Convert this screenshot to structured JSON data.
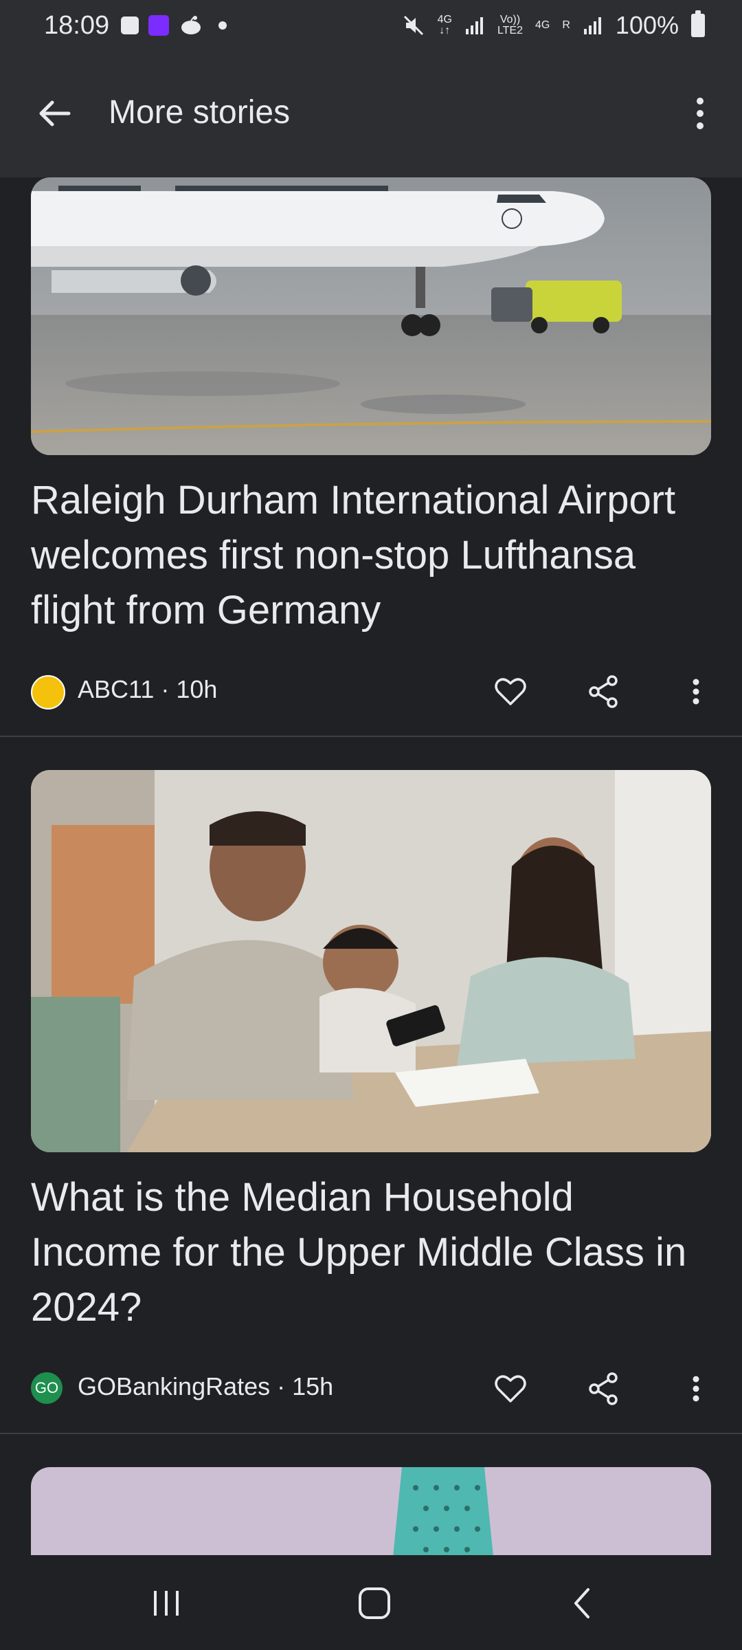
{
  "status_bar": {
    "time": "18:09",
    "network1": "4G",
    "volte": "Vo))",
    "volte_sub": "LTE2",
    "network2": "4G",
    "roaming": "R",
    "battery": "100%"
  },
  "app_bar": {
    "title": "More stories",
    "back_icon": "arrow-back-icon",
    "menu_icon": "more-vert-icon"
  },
  "stories": [
    {
      "headline": "Raleigh Durham International Airport welcomes first non-stop Lufthansa flight from Germany",
      "source_avatar": "",
      "source": "ABC11 · 10h"
    },
    {
      "headline": "What is the Median Household Income for the Upper Middle Class in 2024?",
      "source_avatar": "GO",
      "source": "GOBankingRates · 15h"
    }
  ],
  "colors": {
    "background": "#202124",
    "bars": "#2d2e31",
    "text": "#e8eaed",
    "divider": "#3c4043"
  }
}
